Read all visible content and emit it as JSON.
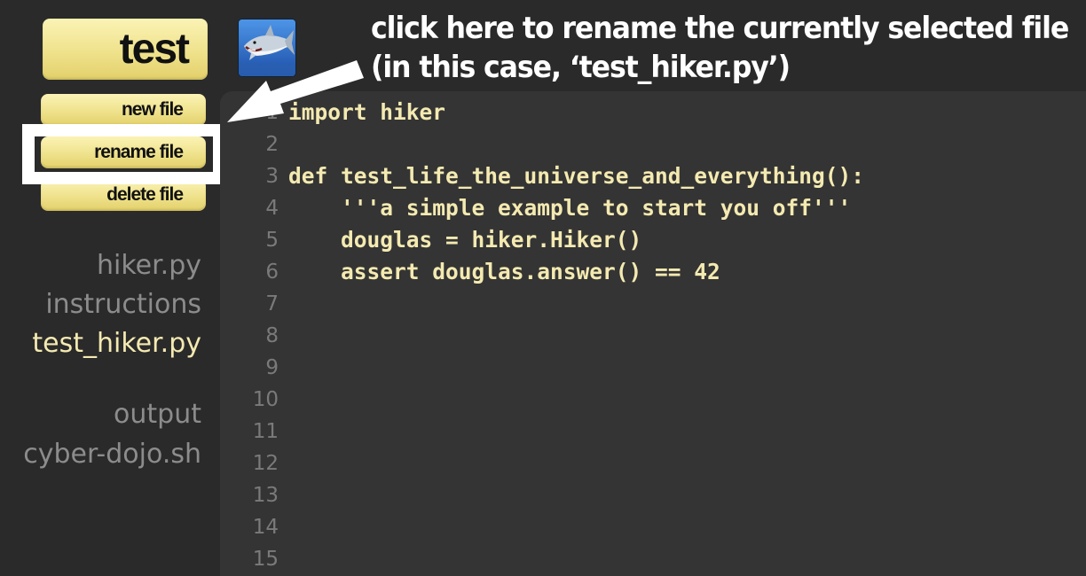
{
  "sidebar": {
    "kata_button": "test",
    "buttons": {
      "new_file": "new file",
      "rename_file": "rename file",
      "delete_file": "delete file"
    },
    "files": [
      "hiker.py",
      "instructions",
      "test_hiker.py"
    ],
    "selected_file": "test_hiker.py",
    "output_files": [
      "output",
      "cyber-dojo.sh"
    ]
  },
  "avatar": {
    "icon": "shark-icon"
  },
  "annotation": {
    "line1": "click here to rename the currently selected file",
    "line2": "(in this case, ‘test_hiker.py’)"
  },
  "editor": {
    "line_numbers": [
      "1",
      "2",
      "3",
      "4",
      "5",
      "6",
      "7",
      "8",
      "9",
      "10",
      "11",
      "12",
      "13",
      "14",
      "15"
    ],
    "lines": [
      "import hiker",
      "",
      "def test_life_the_universe_and_everything():",
      "    '''a simple example to start you off'''",
      "    douglas = hiker.Hiker()",
      "    assert douglas.answer() == 42",
      "",
      "",
      "",
      "",
      "",
      "",
      "",
      "",
      ""
    ]
  },
  "colors": {
    "background": "#2a2a2a",
    "editor_background": "#343434",
    "code_text": "#f4eab1",
    "line_number": "#7a7a7a",
    "file_inactive": "#8c8c8c",
    "file_selected": "#f4eab1",
    "button_yellow": "#efe28c",
    "annotation": "#ffffff"
  }
}
